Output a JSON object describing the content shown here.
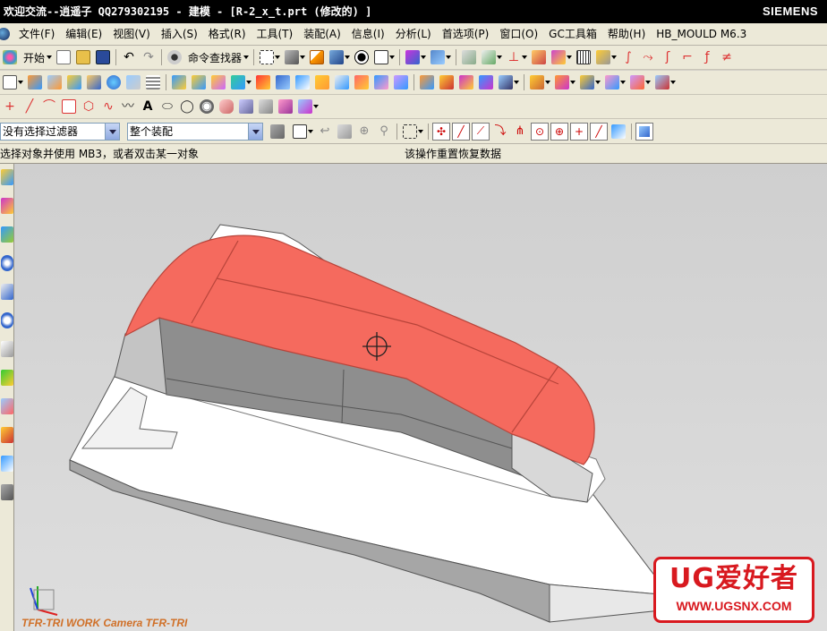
{
  "window": {
    "title": "欢迎交流--逍遥子  QQ279302195 - 建模 - [R-2_x_t.prt  (修改的) ]",
    "brand": "SIEMENS"
  },
  "menu": {
    "items": [
      "文件(F)",
      "编辑(E)",
      "视图(V)",
      "插入(S)",
      "格式(R)",
      "工具(T)",
      "装配(A)",
      "信息(I)",
      "分析(L)",
      "首选项(P)",
      "窗口(O)",
      "GC工具箱",
      "帮助(H)",
      "HB_MOULD M6.3"
    ]
  },
  "toolbar": {
    "start_label": "开始",
    "command_finder_label": "命令查找器"
  },
  "selection_bar": {
    "filter_value": "没有选择过滤器",
    "scope_value": "整个装配"
  },
  "cue_line": {
    "prompt": "选择对象并使用 MB3，或者双击某一对象",
    "status": "该操作重置恢复数据"
  },
  "viewport": {
    "triad_label": "TFR-TRI WORK Camera TFR-TRI",
    "highlight_color": "#f56a5e"
  },
  "watermark": {
    "title": "UG爱好者",
    "url": "WWW.UGSNX.COM",
    "color": "#d8191f"
  }
}
